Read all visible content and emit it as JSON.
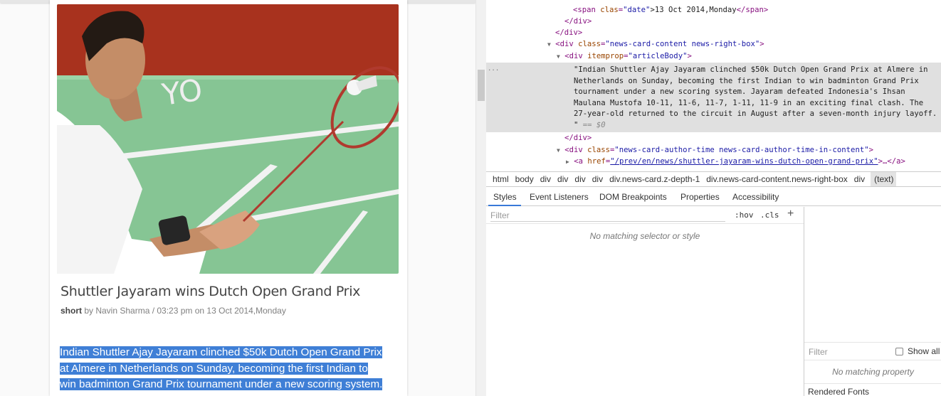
{
  "article": {
    "title": "Shuttler Jayaram wins Dutch Open Grand Prix",
    "meta_short": "short",
    "meta_rest": " by Navin Sharma / 03:23 pm on 13 Oct 2014,Monday",
    "body_lines": [
      "Indian Shuttler Ajay Jayaram clinched $50k Dutch Open Grand Prix",
      "at Almere in Netherlands on Sunday, becoming the first Indian to",
      "win badminton Grand Prix tournament under a new scoring system."
    ],
    "image_desc_icon": "badminton-player-photo"
  },
  "dom": {
    "line_date": {
      "tag_open": "<span",
      "attr": " clas",
      "val": "\"date\"",
      "text": ">13 Oct 2014,Monday",
      "tag_close": "</span>"
    },
    "line_div_close1": "</div>",
    "line_div_close2": "</div>",
    "line_news_content": {
      "tri": "▼",
      "tag_open": "<div",
      "attr": " class",
      "val": "\"news-card-content news-right-box\"",
      "end": ">"
    },
    "line_article_body": {
      "tri": "▼",
      "tag_open": "<div",
      "attr": " itemprop",
      "val": "\"articleBody\"",
      "end": ">"
    },
    "selected_text": "\"Indian Shuttler Ajay Jayaram clinched $50k Dutch Open Grand Prix at Almere in Netherlands on Sunday, becoming the first Indian to win badminton Grand Prix tournament under a new scoring system. Jayaram defeated Indonesia's Ihsan Maulana Mustofa 10-11, 11-6, 11-7, 1-11, 11-9 in an exciting final clash. The 27-year-old returned to the circuit in August after a seven-month injury layoff. \"",
    "selected_marker": " == $0",
    "dots": "...",
    "line_div_close3": "</div>",
    "line_author_time": {
      "tri": "▼",
      "tag_open": "<div",
      "attr": " class",
      "val": "\"news-card-author-time news-card-author-time-in-content\"",
      "end": ">"
    },
    "line_anchor": {
      "tri": "▶",
      "tag_open": "<a",
      "attr": " href",
      "val": "\"/prev/en/news/shuttler-jayaram-wins-dutch-open-grand-prix\"",
      "end": ">…</a>"
    }
  },
  "breadcrumbs": [
    "html",
    "body",
    "div",
    "div",
    "div",
    "div",
    "div.news-card.z-depth-1",
    "div.news-card-content.news-right-box",
    "div",
    "(text)"
  ],
  "subtabs": [
    "Styles",
    "Event Listeners",
    "DOM Breakpoints",
    "Properties",
    "Accessibility"
  ],
  "styles": {
    "filter_placeholder": "Filter",
    "hov": ":hov",
    "cls": ".cls",
    "plus": "+",
    "no_match": "No matching selector or style"
  },
  "computed": {
    "filter_placeholder": "Filter",
    "show_all": "Show all",
    "no_match": "No matching property",
    "rendered_fonts": "Rendered Fonts"
  }
}
